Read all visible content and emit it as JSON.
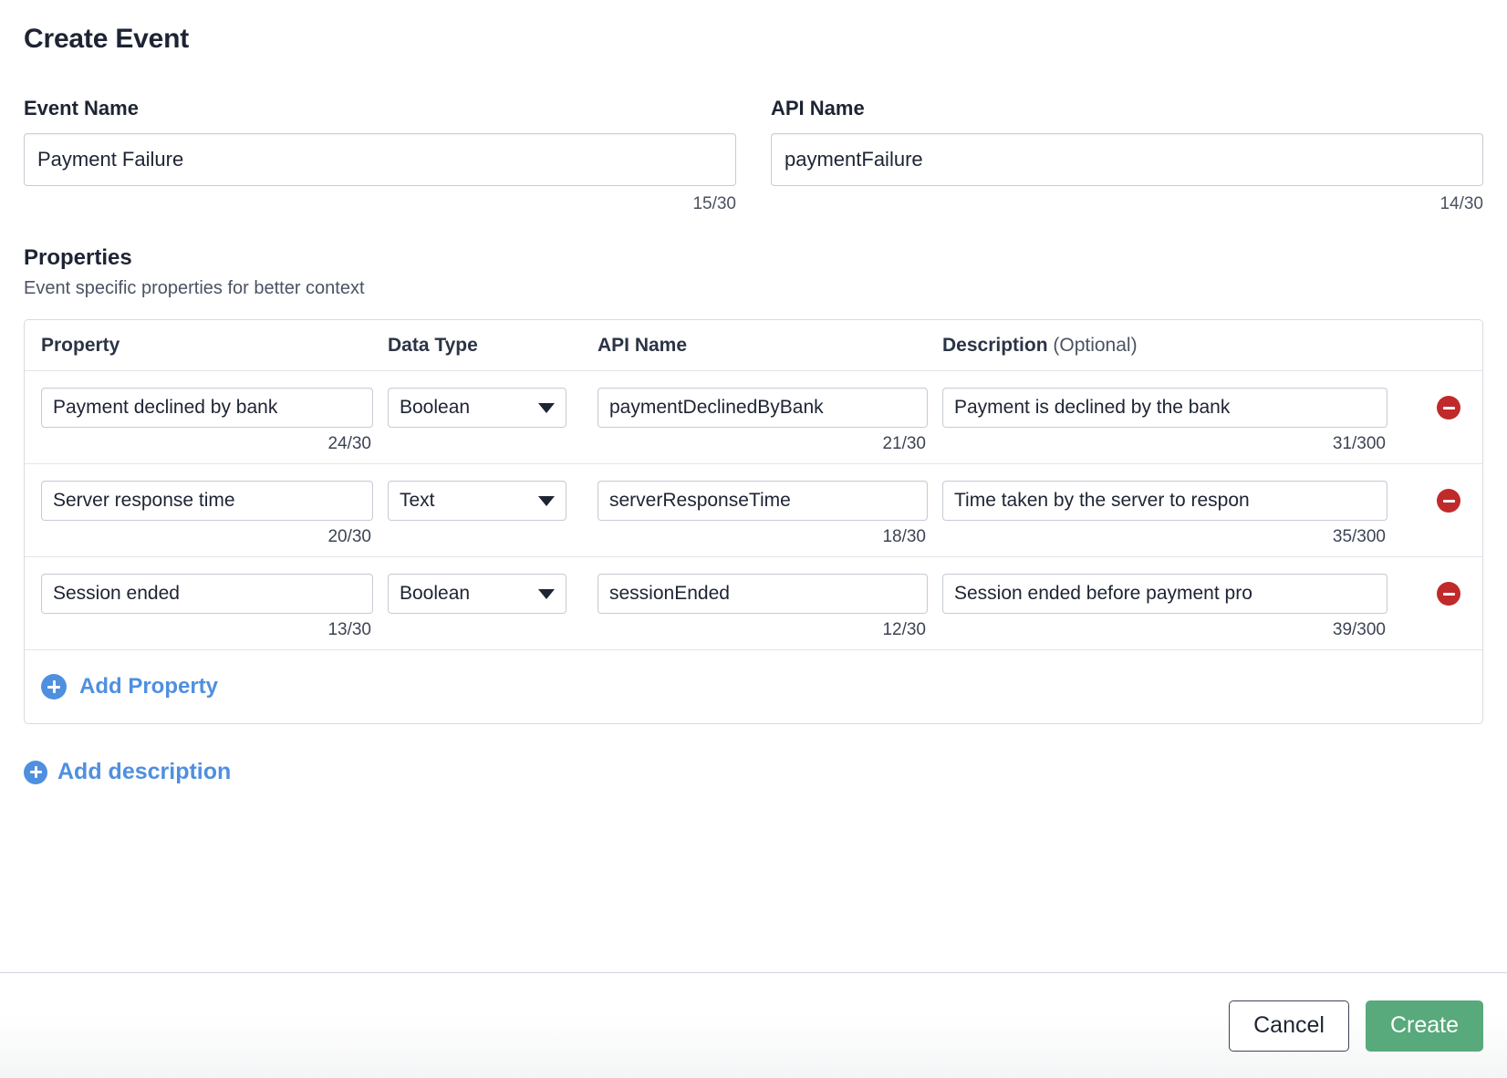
{
  "dialog": {
    "title": "Create Event"
  },
  "event_name": {
    "label": "Event Name",
    "value": "Payment Failure",
    "placeholder": "Event Name",
    "counter": "15/30"
  },
  "api_name": {
    "label": "API Name",
    "value": "paymentFailure",
    "placeholder": "API Name",
    "counter": "14/30"
  },
  "properties_section": {
    "title": "Properties",
    "subtitle": "Event specific properties for better context",
    "columns": {
      "property": "Property",
      "data_type": "Data Type",
      "api_name": "API Name",
      "description": "Description",
      "description_optional": "(Optional)"
    },
    "rows": [
      {
        "property": "Payment declined by bank",
        "property_counter": "24/30",
        "data_type": "Boolean",
        "api_name": "paymentDeclinedByBank",
        "api_name_counter": "21/30",
        "description": "Payment is declined by the bank",
        "description_counter": "31/300",
        "remove_icon": "minus-circle-icon"
      },
      {
        "property": "Server response time",
        "property_counter": "20/30",
        "data_type": "Text",
        "api_name": "serverResponseTime",
        "api_name_counter": "18/30",
        "description": "Time taken by the server to respon",
        "description_counter": "35/300",
        "remove_icon": "minus-circle-icon"
      },
      {
        "property": "Session ended",
        "property_counter": "13/30",
        "data_type": "Boolean",
        "api_name": "sessionEnded",
        "api_name_counter": "12/30",
        "description": "Session ended before payment pro",
        "description_counter": "39/300",
        "remove_icon": "minus-circle-icon"
      }
    ],
    "add_property_label": "Add Property",
    "add_property_icon": "plus-circle-icon"
  },
  "add_description": {
    "label": "Add description",
    "icon": "plus-circle-icon"
  },
  "footer": {
    "cancel_label": "Cancel",
    "create_label": "Create"
  },
  "colors": {
    "accent_blue": "#4f8fe0",
    "remove_red": "#c02a2a",
    "create_green": "#58a97b",
    "text_dark": "#1d2433",
    "border": "#c7ccd6"
  }
}
